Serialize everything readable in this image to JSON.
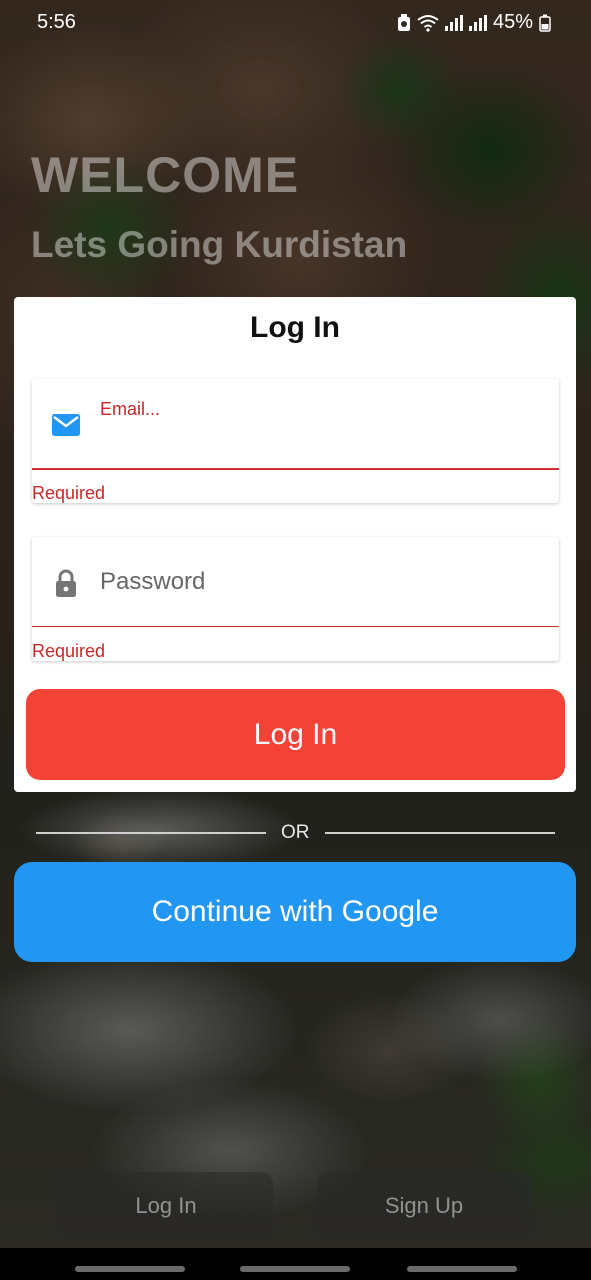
{
  "status_bar": {
    "time": "5:56",
    "battery": "45%"
  },
  "heading": {
    "welcome": "WELCOME",
    "tagline": "Lets Going Kurdistan"
  },
  "login_card": {
    "title": "Log In",
    "email": {
      "label": "Email...",
      "value": "",
      "error": "Required",
      "icon": "mail-icon"
    },
    "password": {
      "placeholder": "Password",
      "value": "",
      "error": "Required",
      "icon": "lock-icon"
    },
    "login_button": "Log In"
  },
  "divider": {
    "text": "OR"
  },
  "google_button": "Continue with Google",
  "bottom_tabs": {
    "login": "Log In",
    "signup": "Sign Up"
  },
  "colors": {
    "primary_red": "#f44336",
    "google_blue": "#2196f3",
    "error_red": "#c62828",
    "mail_icon_blue": "#2196f3"
  }
}
